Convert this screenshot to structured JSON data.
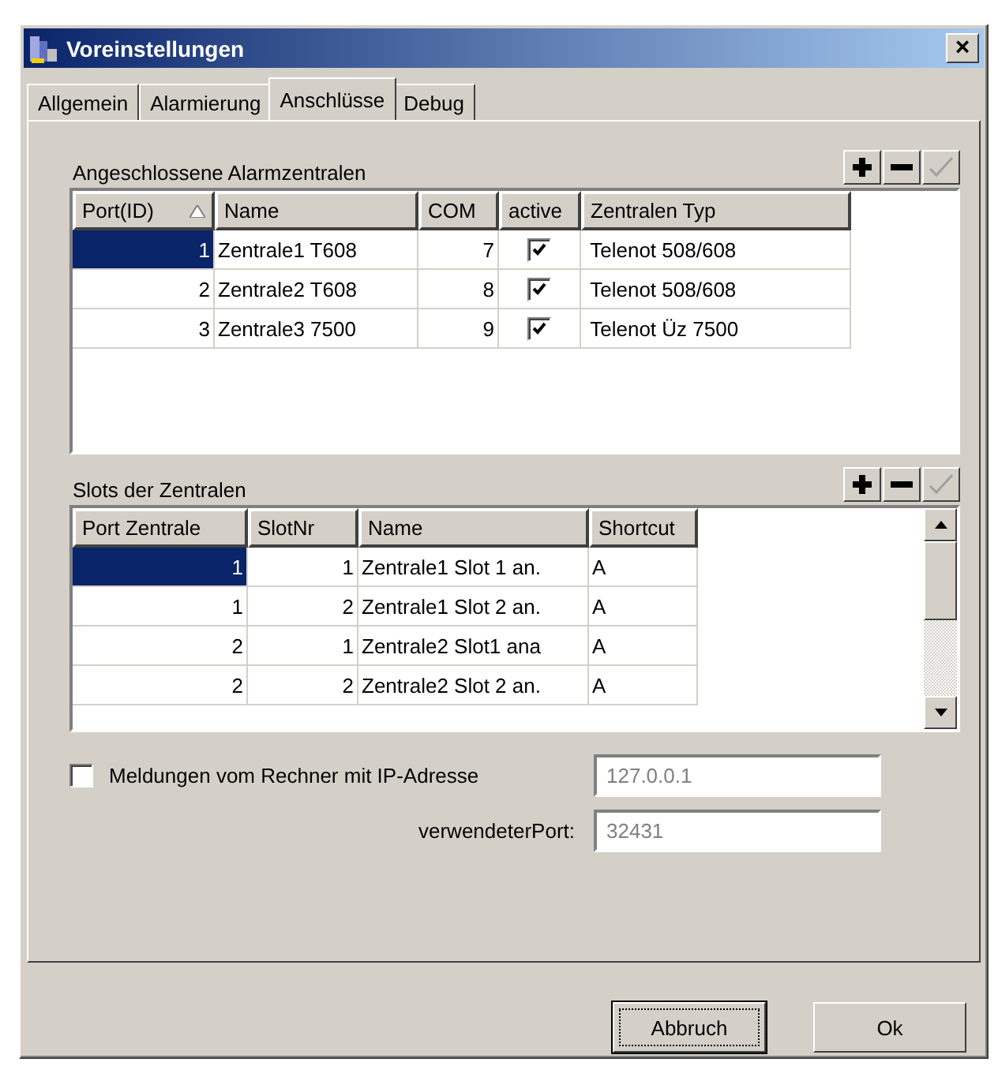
{
  "window": {
    "title": "Voreinstellungen",
    "close": "×"
  },
  "tabs": [
    {
      "label": "Allgemein",
      "selected": false
    },
    {
      "label": "Alarmierung",
      "selected": false
    },
    {
      "label": "Anschlüsse",
      "selected": true
    },
    {
      "label": "Debug",
      "selected": false
    }
  ],
  "centrals": {
    "title": "Angeschlossene Alarmzentralen",
    "tools": [
      {
        "kind": "add",
        "disabled": false
      },
      {
        "kind": "remove",
        "disabled": false
      },
      {
        "kind": "apply",
        "disabled": true
      }
    ],
    "columns": [
      {
        "label": "Port(ID)",
        "sorted": true
      },
      {
        "label": "Name",
        "sorted": false
      },
      {
        "label": "COM",
        "sorted": false
      },
      {
        "label": "active",
        "sorted": false
      },
      {
        "label": "Zentralen Typ",
        "sorted": false
      }
    ],
    "rows": [
      {
        "port": "1",
        "name": "Zentrale1 T608",
        "com": "7",
        "active": true,
        "type": "Telenot 508/608",
        "selected": true
      },
      {
        "port": "2",
        "name": "Zentrale2 T608",
        "com": "8",
        "active": true,
        "type": "Telenot 508/608",
        "selected": false
      },
      {
        "port": "3",
        "name": "Zentrale3 7500",
        "com": "9",
        "active": true,
        "type": "Telenot Üz 7500",
        "selected": false
      }
    ]
  },
  "slots": {
    "title": "Slots der Zentralen",
    "tools": [
      {
        "kind": "add",
        "disabled": false
      },
      {
        "kind": "remove",
        "disabled": false
      },
      {
        "kind": "apply",
        "disabled": true
      }
    ],
    "columns": [
      "Port Zentrale",
      "SlotNr",
      "Name",
      "Shortcut"
    ],
    "rows": [
      {
        "port": "1",
        "slot": "1",
        "name": "Zentrale1 Slot 1 an.",
        "shortcut": "A",
        "selected": true
      },
      {
        "port": "1",
        "slot": "2",
        "name": "Zentrale1 Slot 2 an.",
        "shortcut": "A",
        "selected": false
      },
      {
        "port": "2",
        "slot": "1",
        "name": "Zentrale2 Slot1 ana",
        "shortcut": "A",
        "selected": false
      },
      {
        "port": "2",
        "slot": "2",
        "name": "Zentrale2 Slot 2 an.",
        "shortcut": "A",
        "selected": false
      }
    ]
  },
  "remote": {
    "label": "Meldungen vom Rechner mit IP-Adresse",
    "checked": false,
    "ip": "127.0.0.1",
    "port_label": "verwendeterPort:",
    "port": "32431"
  },
  "buttons": [
    {
      "label": "Abbruch",
      "focused": true
    },
    {
      "label": "Ok",
      "focused": false
    }
  ]
}
